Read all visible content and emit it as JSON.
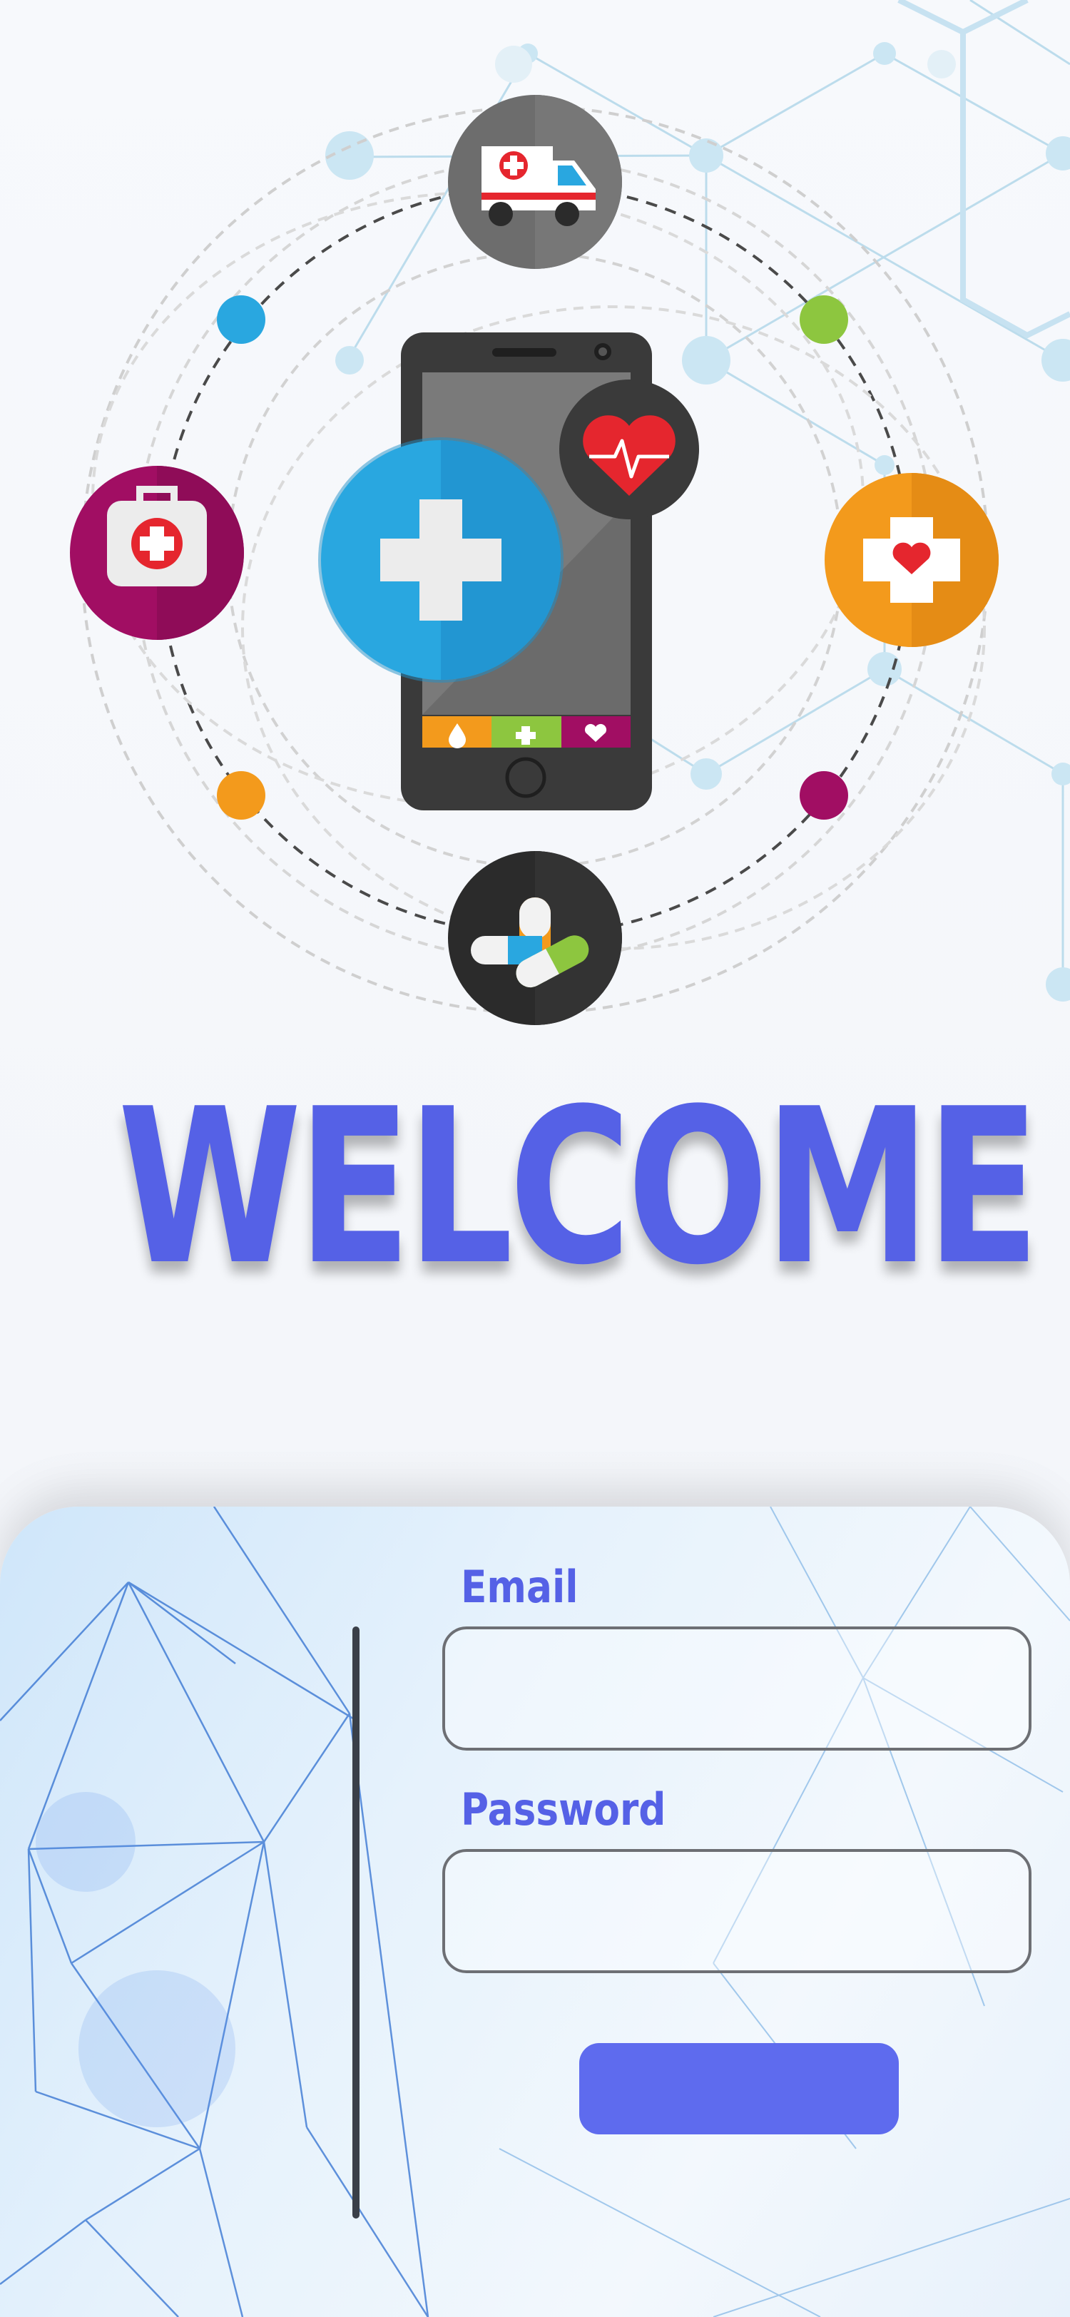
{
  "welcome": {
    "title": "WELCOME"
  },
  "login": {
    "email_label": "Email",
    "email_value": "",
    "password_label": "Password",
    "password_value": "",
    "submit_label": ""
  },
  "colors": {
    "accent": "#5561e6",
    "button": "#5e6bee",
    "blue": "#29a7e0",
    "orange": "#f39a1c",
    "magenta": "#a10e63",
    "green": "#8dc63f",
    "red": "#e5262e"
  },
  "icons": [
    "ambulance-icon",
    "first-aid-kit-icon",
    "medical-cross-heart-icon",
    "pills-icon",
    "smartphone-icon",
    "medical-cross-icon",
    "heartbeat-icon"
  ]
}
